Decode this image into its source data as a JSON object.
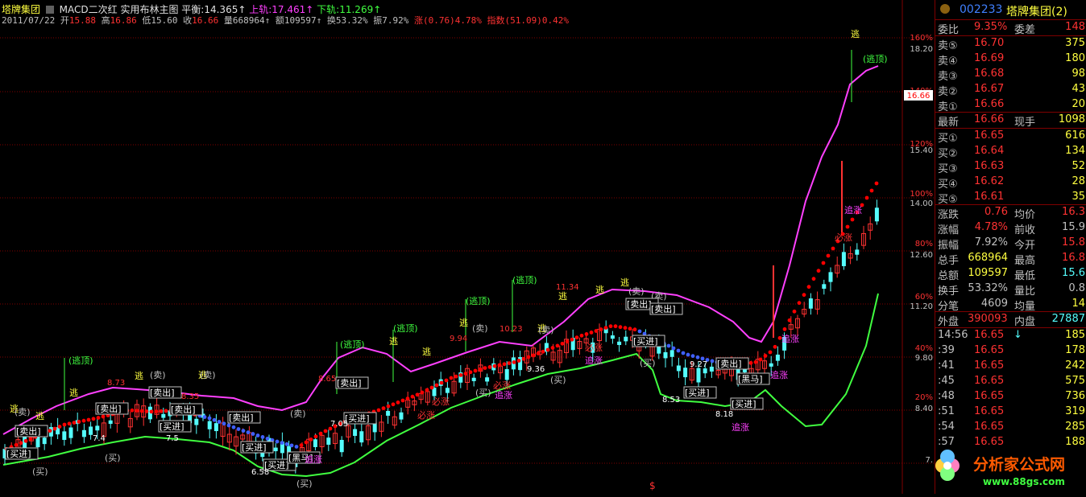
{
  "header": {
    "stock_name": "塔牌集团",
    "indicator": "MACD二次红 实用布林主图",
    "balance_label": "平衡:",
    "balance": "14.365",
    "upper_label": "上轨:",
    "upper": "17.461",
    "lower_label": "下轨:",
    "lower": "11.269",
    "arrow": "↑",
    "date": "2011/07/22",
    "open_label": "开",
    "open": "15.88",
    "high_label": "高",
    "high": "16.86",
    "low_label": "低",
    "low": "15.60",
    "close_label": "收",
    "close": "16.66",
    "vol_label": "量",
    "vol": "668964",
    "amount_label": "额",
    "amount": "109597",
    "turnover_label": "换",
    "turnover": "53.32%",
    "amplitude_label": "振",
    "amplitude": "7.92%",
    "change_label": "涨",
    "change": "(0.76)4.78%",
    "index_label": "指数",
    "index": "(51.09)0.42%"
  },
  "axis": {
    "pct": [
      "160%",
      "140%",
      "120%",
      "100%",
      "80%",
      "60%",
      "40%",
      "20%"
    ],
    "price": [
      "18.20",
      "15.40",
      "14.00",
      "12.60",
      "11.20",
      "9.80",
      "8.40",
      "7."
    ],
    "current_tag": "16.66"
  },
  "chart_annotations": {
    "peak_labels": [
      "8.73",
      "8.35",
      "8.65",
      "9.94",
      "10.23",
      "11.34"
    ],
    "trough_labels": [
      "7.4",
      "7.5",
      "6.58",
      "7.05",
      "9.36",
      "8.53",
      "9.27",
      "8.18"
    ],
    "signals": [
      "逃",
      "(逃顶)",
      "(卖)",
      "[卖出]",
      "[买进]",
      "(买)",
      "[黑马]",
      "追涨",
      "必涨",
      "$"
    ]
  },
  "quote": {
    "title_code": "002233",
    "title_name": "塔牌集团(2)",
    "ratio_label": "委比",
    "ratio": "9.35%",
    "diff_label": "委差",
    "diff": "148",
    "asks": [
      {
        "label": "卖⑤",
        "price": "16.70",
        "vol": "375"
      },
      {
        "label": "卖④",
        "price": "16.69",
        "vol": "180"
      },
      {
        "label": "卖③",
        "price": "16.68",
        "vol": "98"
      },
      {
        "label": "卖②",
        "price": "16.67",
        "vol": "43"
      },
      {
        "label": "卖①",
        "price": "16.66",
        "vol": "20"
      }
    ],
    "last_label": "最新",
    "last": "16.66",
    "hand_label": "现手",
    "hand": "1098",
    "bids": [
      {
        "label": "买①",
        "price": "16.65",
        "vol": "616"
      },
      {
        "label": "买②",
        "price": "16.64",
        "vol": "134"
      },
      {
        "label": "买③",
        "price": "16.63",
        "vol": "52"
      },
      {
        "label": "买④",
        "price": "16.62",
        "vol": "28"
      },
      {
        "label": "买⑤",
        "price": "16.61",
        "vol": "35"
      }
    ],
    "stats": [
      {
        "l1": "涨跌",
        "v1": "0.76",
        "l2": "均价",
        "v2": "16.3"
      },
      {
        "l1": "涨幅",
        "v1": "4.78%",
        "l2": "前收",
        "v2": "15.9"
      },
      {
        "l1": "振幅",
        "v1": "7.92%",
        "l2": "今开",
        "v2": "15.8"
      },
      {
        "l1": "总手",
        "v1": "668964",
        "l2": "最高",
        "v2": "16.8"
      },
      {
        "l1": "总额",
        "v1": "109597",
        "l2": "最低",
        "v2": "15.6"
      },
      {
        "l1": "换手",
        "v1": "53.32%",
        "l2": "量比",
        "v2": "0.8"
      },
      {
        "l1": "分笔",
        "v1": "4609",
        "l2": "均量",
        "v2": "14"
      }
    ],
    "outer_label": "外盘",
    "outer": "390093",
    "inner_label": "内盘",
    "inner": "27887",
    "ticks": [
      {
        "time": "14:56",
        "price": "16.65",
        "arrow": "↓",
        "vol": "185"
      },
      {
        "time": ":39",
        "price": "16.65",
        "arrow": "",
        "vol": "178"
      },
      {
        "time": ":41",
        "price": "16.65",
        "arrow": "",
        "vol": "242"
      },
      {
        "time": ":45",
        "price": "16.65",
        "arrow": "",
        "vol": "575"
      },
      {
        "time": ":48",
        "price": "16.65",
        "arrow": "",
        "vol": "736"
      },
      {
        "time": ":51",
        "price": "16.65",
        "arrow": "",
        "vol": "319"
      },
      {
        "time": ":54",
        "price": "16.65",
        "arrow": "",
        "vol": "285"
      },
      {
        "time": ":57",
        "price": "16.65",
        "arrow": "",
        "vol": "188"
      }
    ]
  },
  "logo": {
    "name": "分析家公式网",
    "url": "www.88gs.com"
  },
  "colors": {
    "up": "#ff3232",
    "down": "#54fcfc",
    "upper": "#ff40ff",
    "lower": "#40ff40",
    "mid_up": "#ff0000",
    "mid_down": "#4060ff",
    "yellow": "#ffff40",
    "grid": "#7f0000"
  }
}
